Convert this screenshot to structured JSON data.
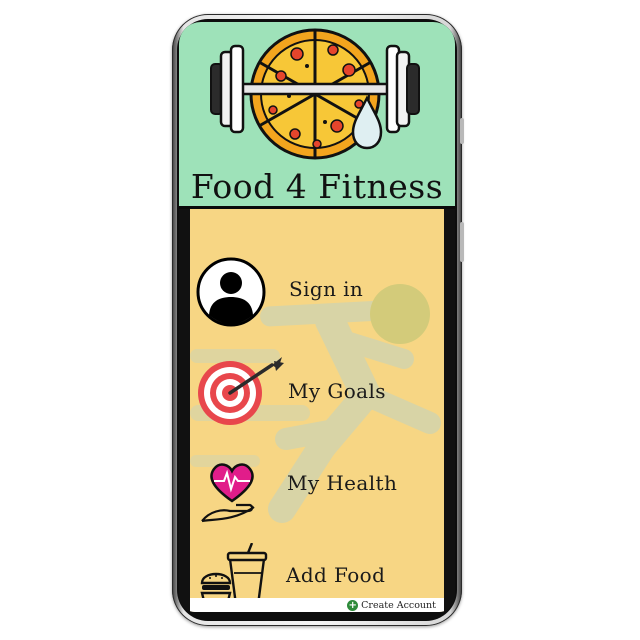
{
  "app": {
    "title": "Food 4 Fitness"
  },
  "menu": [
    {
      "label": "Sign in",
      "icon": "user-avatar-icon"
    },
    {
      "label": "My Goals",
      "icon": "target-dart-icon"
    },
    {
      "label": "My Health",
      "icon": "heart-in-hand-icon"
    },
    {
      "label": "Add Food",
      "icon": "food-burger-drink-icon"
    }
  ],
  "footer": {
    "create_account": "Create Account",
    "icon": "plus-circle-icon"
  },
  "colors": {
    "header_bg": "#9ee2b9",
    "main_bg": "#f7d684",
    "runner": "#d8d4a6",
    "target_red": "#e8474c",
    "heart_pink": "#e11d8a",
    "create_account_green": "#2e8b3a"
  }
}
